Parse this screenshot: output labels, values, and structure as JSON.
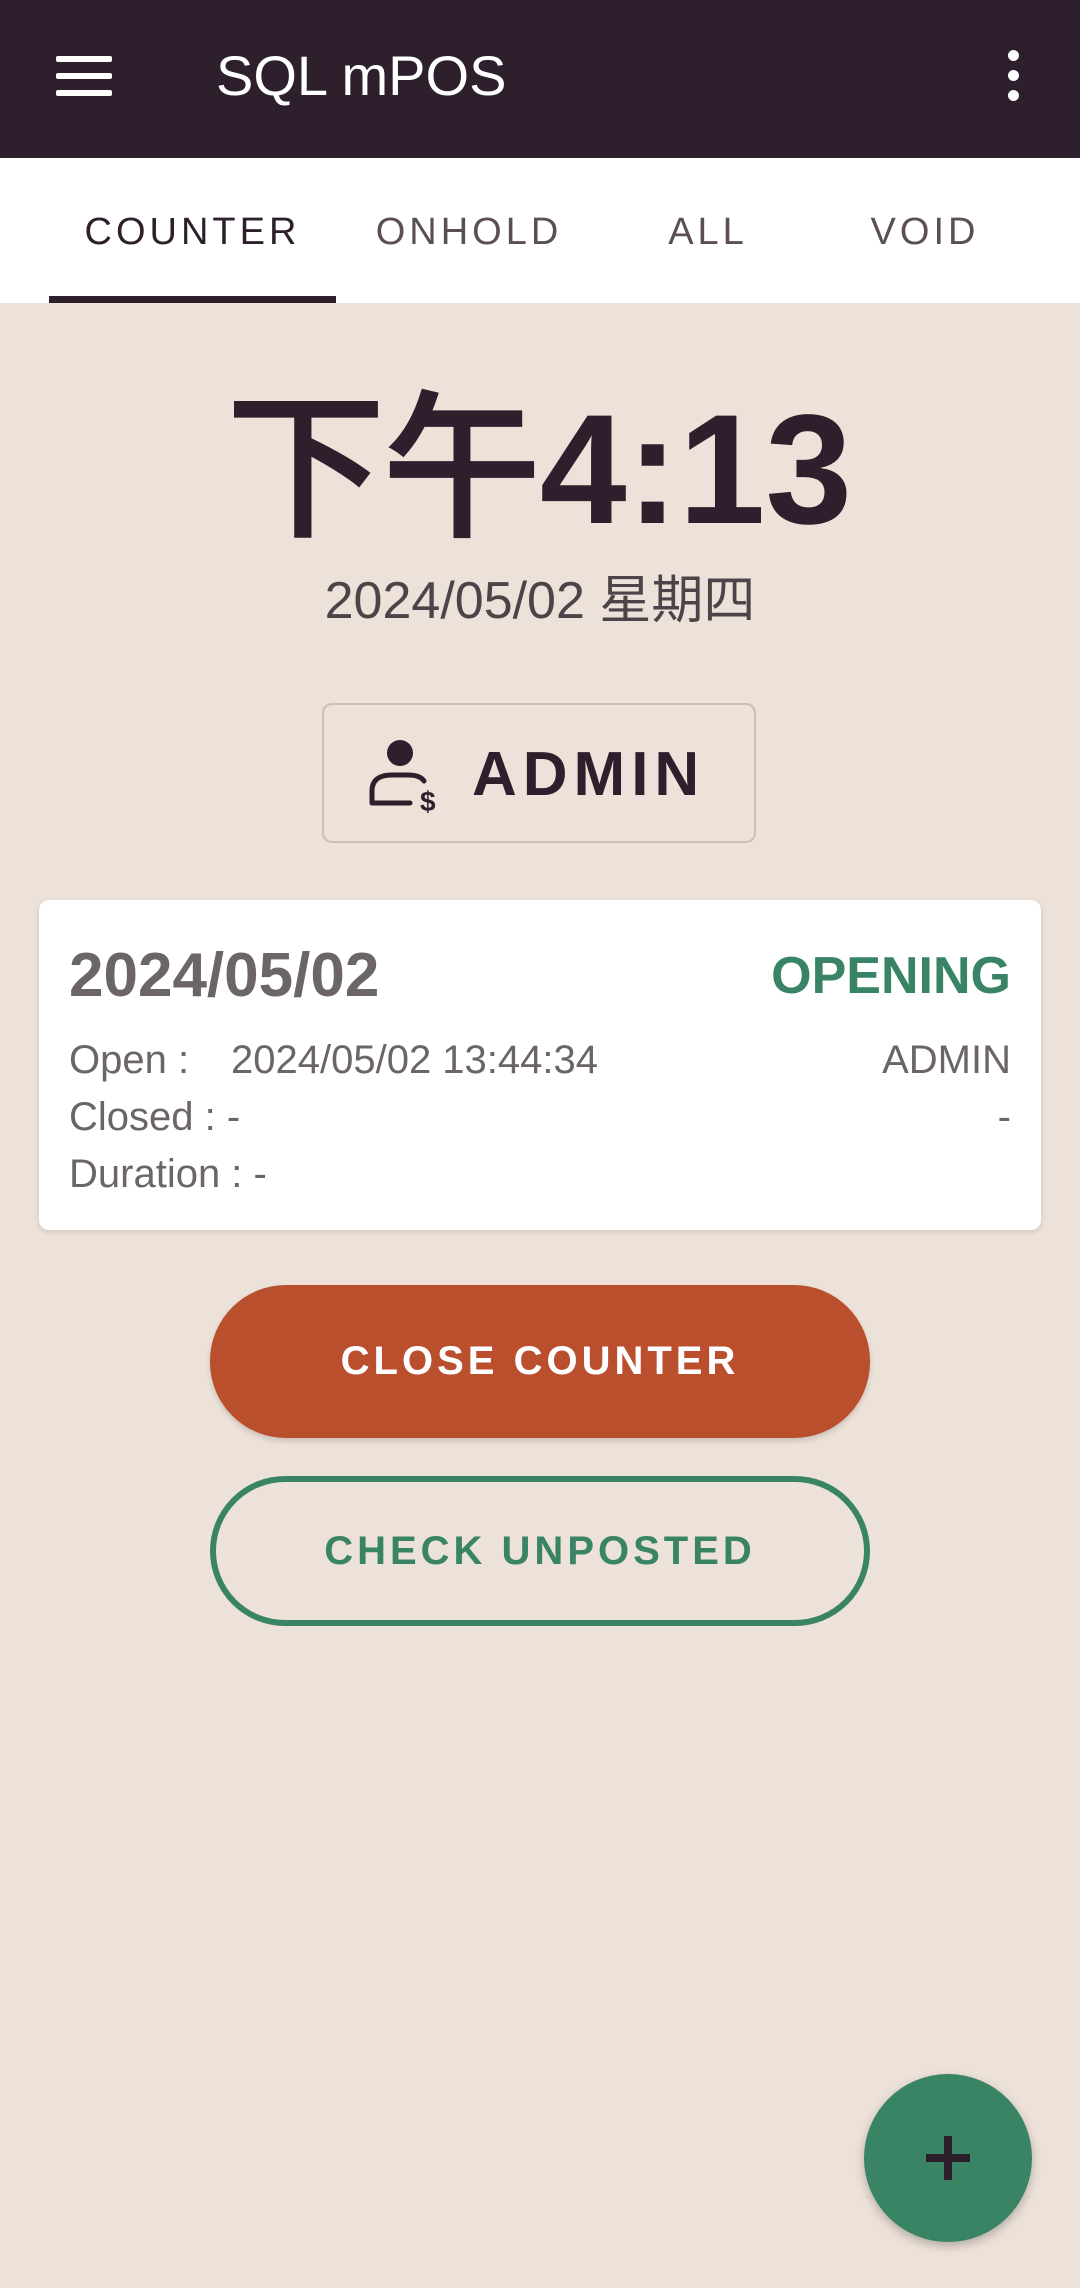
{
  "app": {
    "title": "SQL mPOS",
    "menu_icon": "hamburger-menu-icon",
    "overflow_icon": "more-vert-icon"
  },
  "tabs": [
    {
      "label": "COUNTER",
      "active": true
    },
    {
      "label": "ONHOLD",
      "active": false
    },
    {
      "label": "ALL",
      "active": false
    },
    {
      "label": "VOID",
      "active": false
    }
  ],
  "clock": {
    "time": "下午4:13",
    "date": "2024/05/02  星期四"
  },
  "user": {
    "name": "ADMIN",
    "icon": "cashier-user-icon"
  },
  "session": {
    "date": "2024/05/02",
    "status": "OPENING",
    "open_label": "Open :",
    "open_value": "2024/05/02 13:44:34",
    "open_user": "ADMIN",
    "closed_label": "Closed : -",
    "closed_user": "-",
    "duration_label": "Duration : -"
  },
  "actions": {
    "close_counter": "CLOSE COUNTER",
    "check_unposted": "CHECK UNPOSTED"
  },
  "fab": {
    "icon": "plus-icon"
  },
  "colors": {
    "app_bar": "#2e1f2c",
    "background": "#ede2d9",
    "status_green": "#3a8466",
    "close_button": "#ba4f2e"
  }
}
